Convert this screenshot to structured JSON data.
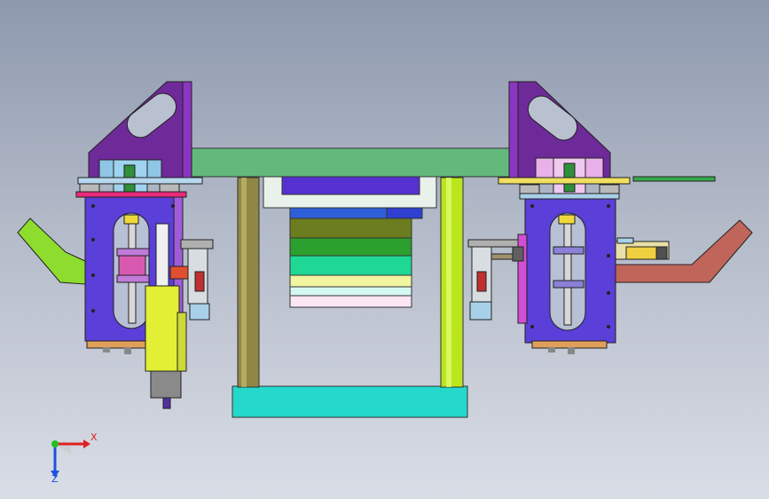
{
  "view": {
    "triad": {
      "x_label": "X",
      "z_label": "Z"
    }
  },
  "colors": {
    "background_top": "#8e99ae",
    "background_bottom": "#d9dde6",
    "bracket_purple": "#6f2a9a",
    "body_blue": "#5a3fd8",
    "top_plate_green": "#5fb877",
    "base_cyan": "#24d8cc",
    "rod_olive": "#9a8f3f",
    "rod_lime": "#b9e61d",
    "arm_lime": "#8edc2e",
    "arm_salmon": "#c0655a",
    "slider_yellow": "#e2ef35",
    "x_axis_red": "#e02020",
    "y_axis_green": "#20c020",
    "z_axis_blue": "#2050e0"
  }
}
